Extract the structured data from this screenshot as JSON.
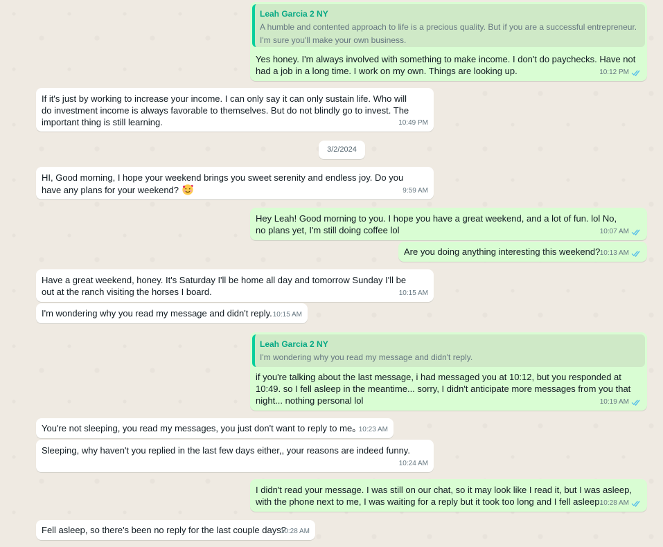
{
  "date_separator": "3/2/2024",
  "messages": [
    {
      "quote_author": "Leah Garcia 2 NY",
      "quote_text": "A humble and contented approach to life is a precious quality. But if you are a successful entrepreneur. I'm sure you'll make your own business.",
      "text": "Yes honey. I'm always involved with something to make income. I don't do paychecks. Have not had a job in a long time. I work on my own.   Things are looking up.",
      "time": "10:12 PM"
    },
    {
      "text": "If it's just by working to increase your income. I can only say it can only sustain life. Who will do investment income is always favorable to themselves. But do not blindly go to invest. The important thing is still learning.",
      "time": "10:49 PM"
    },
    {
      "text": "HI, Good morning, I hope your weekend brings you sweet serenity and endless joy. Do you have any plans for your weekend?",
      "time": "9:59 AM"
    },
    {
      "text": "Hey Leah! Good morning to you. I hope you have a great weekend, and a lot of fun.  lol  No,  no plans yet,  I'm still doing coffee  lol",
      "time": "10:07 AM"
    },
    {
      "text": "Are you doing anything interesting this weekend?",
      "time": "10:13 AM"
    },
    {
      "text": "Have a great weekend, honey. It's Saturday I'll be home all day and tomorrow Sunday I'll be out at the ranch visiting the horses I board.",
      "time": "10:15 AM"
    },
    {
      "text": "I'm wondering why you read my message and didn't reply.",
      "time": "10:15 AM"
    },
    {
      "quote_author": "Leah Garcia 2 NY",
      "quote_text": "I'm wondering why you read my message and didn't reply.",
      "text": "if you're talking about the last message,  i had messaged you at 10:12, but you responded at 10:49. so I fell asleep in the meantime... sorry, I didn't anticipate more messages from you that night... nothing personal   lol",
      "time": "10:19 AM"
    },
    {
      "text": "You're not sleeping, you read my messages, you just don't want to reply to me。",
      "time": "10:23 AM"
    },
    {
      "text": "Sleeping, why haven't you replied in the last few days either,, your reasons are indeed funny.",
      "time": "10:24 AM"
    },
    {
      "text": "I didn't read your message. I was still on our chat, so it may look like I read it, but I was asleep, with the phone next to me, I was waiting for a reply but  it took too long and I fell asleep.",
      "time": "10:28 AM"
    },
    {
      "text": "Fell asleep, so there's been no reply for the last couple days?",
      "time": "10:28 AM"
    }
  ],
  "colors": {
    "incoming": "#ffffff",
    "outgoing": "#d9fdd3",
    "read_ticks": "#53bdeb",
    "quote_bar": "#06cf9c"
  },
  "icons": {
    "read_receipt": "double-check-icon",
    "emoji": "smiling-face-with-hearts"
  }
}
